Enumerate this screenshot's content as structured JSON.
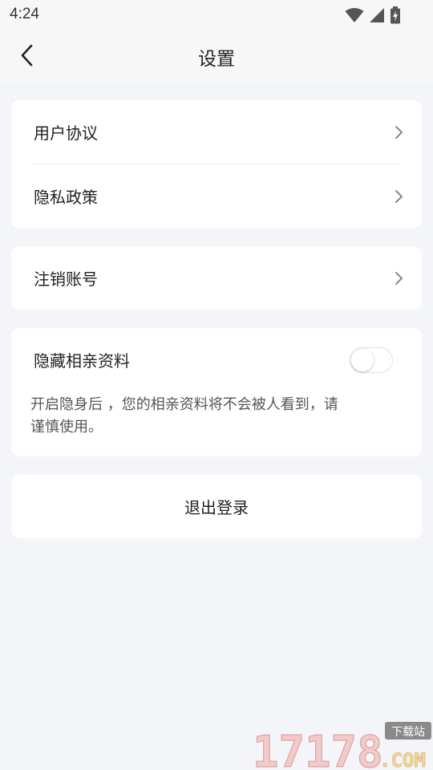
{
  "status_bar": {
    "time": "4:24"
  },
  "nav": {
    "title": "设置"
  },
  "menu": {
    "user_agreement": "用户协议",
    "privacy_policy": "隐私政策",
    "delete_account": "注销账号"
  },
  "hide_profile": {
    "label": "隐藏相亲资料",
    "enabled": false,
    "hint": "开启隐身后 ，您的相亲资料将不会被人看到，请谨慎使用。"
  },
  "logout": {
    "label": "退出登录"
  },
  "watermark": {
    "main": "17178",
    "badge": "下载站",
    "suffix": ".COM"
  }
}
